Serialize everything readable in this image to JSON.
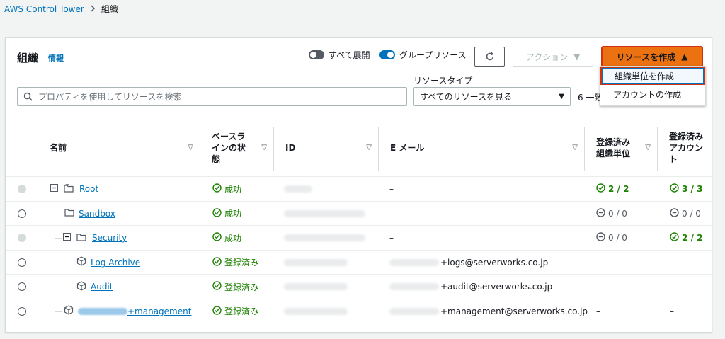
{
  "breadcrumb": {
    "root": "AWS Control Tower",
    "current": "組織"
  },
  "header": {
    "title": "組織",
    "info": "情報"
  },
  "toggles": {
    "expand_all": "すべて展開",
    "group_resources": "グループリソース"
  },
  "buttons": {
    "action": "アクション",
    "create": "リソースを作成"
  },
  "create_menu": {
    "item1": "組織単位を作成",
    "item2": "アカウントの作成"
  },
  "search": {
    "placeholder": "プロパティを使用してリソースを検索"
  },
  "resource_type": {
    "label": "リソースタイプ",
    "value": "すべてのリソースを見る"
  },
  "count_text": "6 一致",
  "columns": {
    "name": "名前",
    "baseline1": "ベースラ",
    "baseline2": "インの状",
    "baseline3": "態",
    "id": "ID",
    "email": "E メール",
    "ou1": "登録済み",
    "ou2": "組織単位",
    "acct1": "登録済み",
    "acct2": "アカウン",
    "acct3": "ト"
  },
  "rows": [
    {
      "name": "Root",
      "status": "成功",
      "email": "–",
      "ou": "2 / 2",
      "acct": "3 / 3"
    },
    {
      "name": "Sandbox",
      "status": "成功",
      "email": "–",
      "ou": "0 / 0",
      "acct": "0 / 0"
    },
    {
      "name": "Security",
      "status": "成功",
      "email": "–",
      "ou": "0 / 0",
      "acct": "2 / 2"
    },
    {
      "name": "Log Archive",
      "status": "登録済み",
      "email": "+logs@serverworks.co.jp",
      "ou": "–",
      "acct": "–"
    },
    {
      "name": "Audit",
      "status": "登録済み",
      "email": "+audit@serverworks.co.jp",
      "ou": "–",
      "acct": "–"
    },
    {
      "name": "+management",
      "status": "登録済み",
      "email": "+management@serverworks.co.jp",
      "ou": "–",
      "acct": "–"
    }
  ],
  "colors": {
    "accent": "#0073bb",
    "success": "#1d8102",
    "primary": "#ec7211",
    "highlight": "#d13212"
  }
}
